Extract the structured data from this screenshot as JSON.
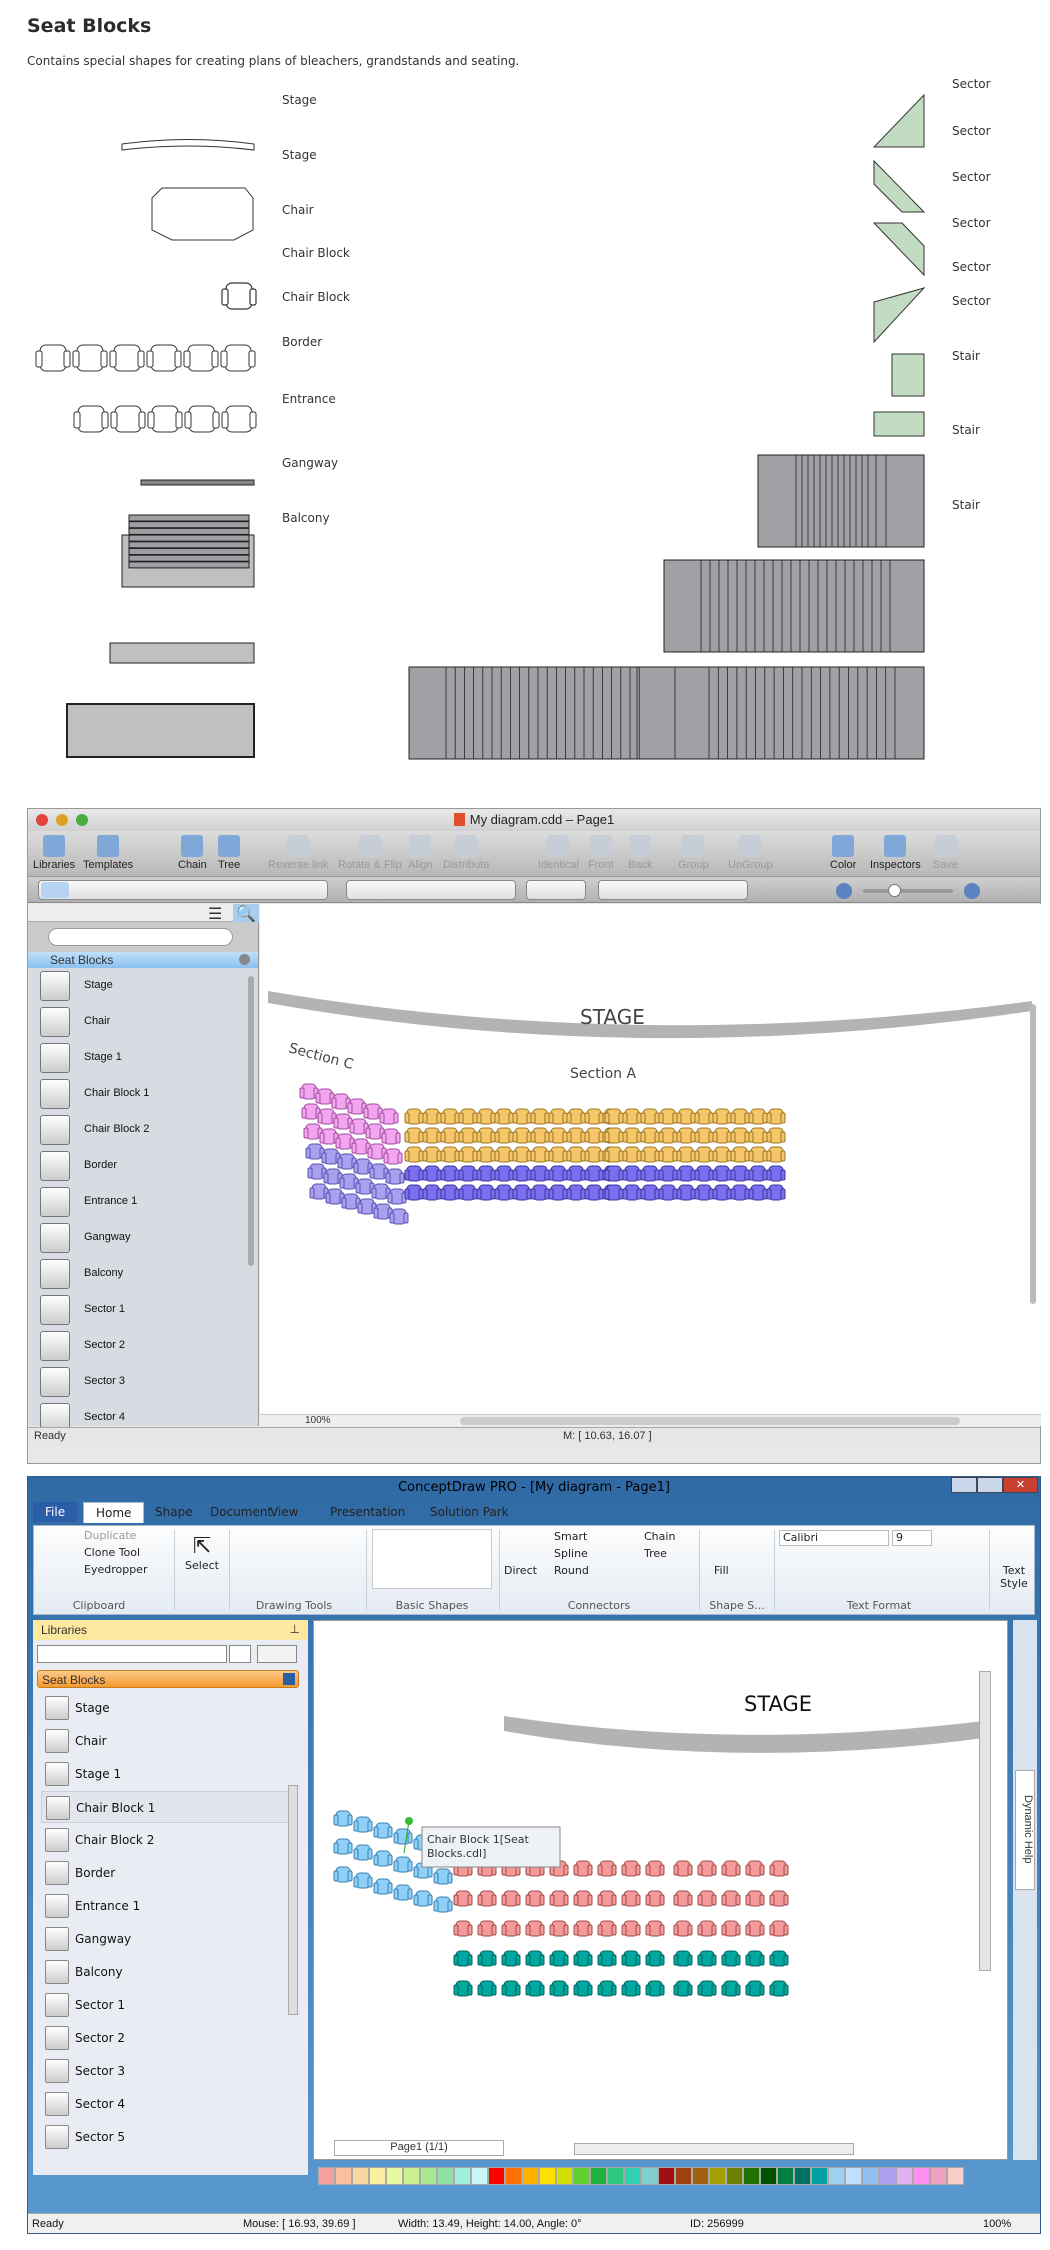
{
  "header": {
    "title": "Seat Blocks",
    "description": "Contains special shapes for creating plans of bleachers, grandstands and seating."
  },
  "shapes_left": [
    {
      "label": "Stage",
      "icon": "stage-arc-icon"
    },
    {
      "label": "Stage",
      "icon": "stage-icon"
    },
    {
      "label": "Chair",
      "icon": "chair-icon"
    },
    {
      "label": "Chair Block",
      "icon": "chair-block-6-icon"
    },
    {
      "label": "Chair Block",
      "icon": "chair-block-5-icon"
    },
    {
      "label": "Border",
      "icon": "border-icon"
    },
    {
      "label": "Entrance",
      "icon": "entrance-icon"
    },
    {
      "label": "Gangway",
      "icon": "gangway-icon"
    },
    {
      "label": "Balcony",
      "icon": "balcony-icon"
    }
  ],
  "shapes_right": [
    {
      "label": "Sector",
      "icon": "sector-1-icon"
    },
    {
      "label": "Sector",
      "icon": "sector-2-icon"
    },
    {
      "label": "Sector",
      "icon": "sector-3-icon"
    },
    {
      "label": "Sector",
      "icon": "sector-4-icon"
    },
    {
      "label": "Sector",
      "icon": "sector-5-icon"
    },
    {
      "label": "Sector",
      "icon": "sector-6-icon"
    },
    {
      "label": "Stair",
      "icon": "stair-small-icon"
    },
    {
      "label": "Stair",
      "icon": "stair-medium-icon"
    },
    {
      "label": "Stair",
      "icon": "stair-large-icon"
    }
  ],
  "mac": {
    "title": "My diagram.cdd – Page1",
    "toolbar": [
      {
        "label": "Libraries",
        "enabled": true
      },
      {
        "label": "Templates",
        "enabled": true
      },
      {
        "label": "Chain",
        "enabled": true
      },
      {
        "label": "Tree",
        "enabled": true
      },
      {
        "label": "Reverse link",
        "enabled": false
      },
      {
        "label": "Rotate & Flip",
        "enabled": false
      },
      {
        "label": "Align",
        "enabled": false
      },
      {
        "label": "Distribute",
        "enabled": false
      },
      {
        "label": "Identical",
        "enabled": false
      },
      {
        "label": "Front",
        "enabled": false
      },
      {
        "label": "Back",
        "enabled": false
      },
      {
        "label": "Group",
        "enabled": false
      },
      {
        "label": "UnGroup",
        "enabled": false
      },
      {
        "label": "Color",
        "enabled": true
      },
      {
        "label": "Inspectors",
        "enabled": true
      },
      {
        "label": "Save",
        "enabled": false
      }
    ],
    "search_placeholder": "",
    "library_title": "Seat Blocks",
    "library_items": [
      "Stage",
      "Chair",
      "Stage 1",
      "Chair Block 1",
      "Chair Block 2",
      "Border",
      "Entrance 1",
      "Gangway",
      "Balcony",
      "Sector 1",
      "Sector 2",
      "Sector 3",
      "Sector 4"
    ],
    "canvas": {
      "stage_label": "STAGE",
      "section_c": "Section C",
      "section_a": "Section A"
    },
    "zoom": "100%",
    "status": "Ready",
    "mouse": "M: [ 10.63, 16.07 ]"
  },
  "win": {
    "title": "ConceptDraw PRO - [My diagram - Page1]",
    "tabs": [
      "File",
      "Home",
      "Shape",
      "Document",
      "View",
      "Presentation",
      "Solution Park"
    ],
    "active_tab": "Home",
    "clipboard": {
      "items": [
        "Duplicate",
        "Clone Tool",
        "Eyedropper"
      ],
      "label": "Clipboard"
    },
    "select_label": "Select",
    "drawing_tools_label": "Drawing Tools",
    "basic_shapes_label": "Basic Shapes",
    "connectors": {
      "direct": "Direct",
      "smart": "Smart",
      "spline": "Spline",
      "round": "Round",
      "chain": "Chain",
      "tree": "Tree",
      "label": "Connectors"
    },
    "shape_style": {
      "fill": "Fill",
      "label": "Shape S..."
    },
    "text_format": {
      "font": "Calibri",
      "size": "9",
      "label": "Text Format"
    },
    "text_style": "Text Style",
    "libraries_title": "Libraries",
    "library_title": "Seat Blocks",
    "library_items": [
      "Stage",
      "Chair",
      "Stage 1",
      "Chair Block 1",
      "Chair Block 2",
      "Border",
      "Entrance 1",
      "Gangway",
      "Balcony",
      "Sector 1",
      "Sector 2",
      "Sector 3",
      "Sector 4",
      "Sector 5"
    ],
    "selected_item": "Chair Block 1",
    "canvas": {
      "stage_label": "STAGE",
      "tooltip": "Chair Block 1[Seat Blocks.cdl]"
    },
    "dynamic_help": "Dynamic Help",
    "page_selector": "Page1 (1/1)",
    "palette": [
      "#f4a0a0",
      "#f8c0a0",
      "#f8d8a0",
      "#f8f0a0",
      "#e8f8a0",
      "#c8f090",
      "#a8e890",
      "#90e0a8",
      "#a0f0e0",
      "#c8f8f8",
      "#ff0000",
      "#ff7000",
      "#ffb000",
      "#ffe000",
      "#d0e000",
      "#60d030",
      "#20b040",
      "#30c880",
      "#30d0b0",
      "#80d0d0",
      "#a01010",
      "#a04010",
      "#a06010",
      "#a0a000",
      "#708000",
      "#207000",
      "#005000",
      "#008040",
      "#007060",
      "#00a0a0",
      "#a0d0f0",
      "#c0e0ff",
      "#90c0f0",
      "#b0a0f0",
      "#e0b0f0",
      "#ff90f0",
      "#f0a0c0",
      "#f8d0c8"
    ],
    "status": {
      "ready": "Ready",
      "mouse": "Mouse: [ 16.93, 39.69 ]",
      "size": "Width: 13.49,  Height: 14.00,  Angle: 0°",
      "id": "ID: 256999",
      "zoom": "100%"
    }
  }
}
